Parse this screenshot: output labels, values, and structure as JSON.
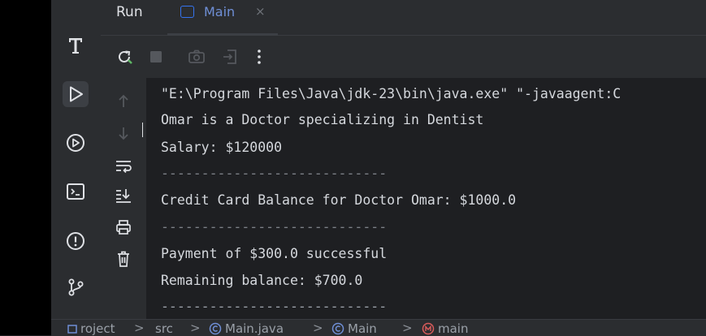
{
  "window": {
    "run_label": "Run",
    "tab": {
      "label": "Main",
      "close": "×"
    }
  },
  "console": {
    "lines": [
      "\"E:\\Program Files\\Java\\jdk-23\\bin\\java.exe\" \"-javaagent:C",
      "Omar is a Doctor specializing in Dentist",
      "Salary: $120000",
      "----------------------------",
      "Credit Card Balance for Doctor Omar: $1000.0",
      "----------------------------",
      "Payment of $300.0 successful",
      "Remaining balance: $700.0",
      "----------------------------"
    ]
  },
  "breadcrumb": {
    "project": "roject",
    "src": "src",
    "file": "Main.java",
    "class": "Main",
    "method": "main",
    "separator": ">"
  },
  "colors": {
    "accent": "#3574f0",
    "method_icon": "#d95b5b"
  },
  "icons": {
    "sidebar": [
      "text-tool-icon",
      "run-icon",
      "debug-icon",
      "terminal-icon",
      "problems-icon",
      "git-icon"
    ],
    "toolbar": [
      "rerun-icon",
      "stop-icon",
      "camera-icon",
      "exit-icon",
      "more-icon"
    ],
    "gutter": [
      "up-arrow-icon",
      "down-arrow-icon",
      "soft-wrap-icon",
      "scroll-to-end-icon",
      "print-icon",
      "trash-icon"
    ]
  }
}
